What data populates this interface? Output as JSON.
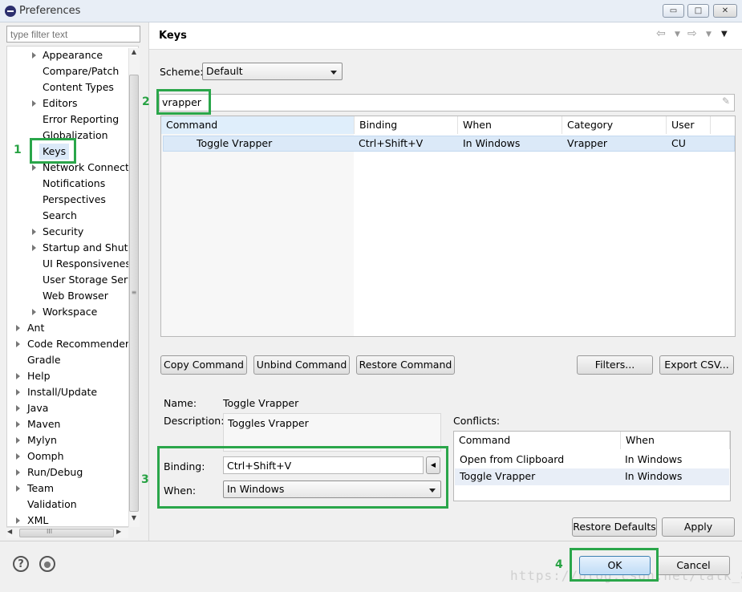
{
  "window": {
    "title": "Preferences",
    "min_glyph": "▭",
    "max_glyph": "□",
    "close_glyph": "✕"
  },
  "filter": {
    "placeholder": "type filter text"
  },
  "tree": {
    "items": [
      {
        "label": "Appearance",
        "arrow": true
      },
      {
        "label": "Compare/Patch",
        "arrow": false
      },
      {
        "label": "Content Types",
        "arrow": false
      },
      {
        "label": "Editors",
        "arrow": true
      },
      {
        "label": "Error Reporting",
        "arrow": false
      },
      {
        "label": "Globalization",
        "arrow": false
      },
      {
        "label": "Keys",
        "arrow": false,
        "selected": true
      },
      {
        "label": "Network Connectio",
        "arrow": true
      },
      {
        "label": "Notifications",
        "arrow": false
      },
      {
        "label": "Perspectives",
        "arrow": false
      },
      {
        "label": "Search",
        "arrow": false
      },
      {
        "label": "Security",
        "arrow": true
      },
      {
        "label": "Startup and Shutd",
        "arrow": true
      },
      {
        "label": "UI Responsiveness",
        "arrow": false
      },
      {
        "label": "User Storage Serv",
        "arrow": false
      },
      {
        "label": "Web Browser",
        "arrow": false
      },
      {
        "label": "Workspace",
        "arrow": true
      }
    ],
    "top_items": [
      {
        "label": "Ant",
        "arrow": true
      },
      {
        "label": "Code Recommenders",
        "arrow": true
      },
      {
        "label": "Gradle",
        "arrow": false
      },
      {
        "label": "Help",
        "arrow": true
      },
      {
        "label": "Install/Update",
        "arrow": true
      },
      {
        "label": "Java",
        "arrow": true
      },
      {
        "label": "Maven",
        "arrow": true
      },
      {
        "label": "Mylyn",
        "arrow": true
      },
      {
        "label": "Oomph",
        "arrow": true
      },
      {
        "label": "Run/Debug",
        "arrow": true
      },
      {
        "label": "Team",
        "arrow": true
      },
      {
        "label": "Validation",
        "arrow": false
      },
      {
        "label": "XML",
        "arrow": true
      }
    ],
    "scroll_h_thumb": "III"
  },
  "page": {
    "title": "Keys",
    "scheme_label": "Scheme:",
    "scheme_value": "Default",
    "search_value": "vrapper",
    "columns": [
      "Command",
      "Binding",
      "When",
      "Category",
      "User"
    ],
    "rows": [
      {
        "command": "Toggle Vrapper",
        "binding": "Ctrl+Shift+V",
        "when": "In Windows",
        "category": "Vrapper",
        "user": "CU"
      }
    ],
    "buttons": {
      "copy": "Copy Command",
      "unbind": "Unbind Command",
      "restore": "Restore Command",
      "filters": "Filters...",
      "export": "Export CSV..."
    },
    "details": {
      "name_label": "Name:",
      "name_value": "Toggle Vrapper",
      "desc_label": "Description:",
      "desc_value": "Toggles Vrapper",
      "binding_label": "Binding:",
      "binding_value": "Ctrl+Shift+V",
      "when_label": "When:",
      "when_value": "In Windows"
    },
    "conflicts": {
      "label": "Conflicts:",
      "columns": [
        "Command",
        "When"
      ],
      "rows": [
        {
          "command": "Open from Clipboard",
          "when": "In Windows"
        },
        {
          "command": "Toggle Vrapper",
          "when": "In Windows"
        }
      ]
    },
    "restore_defaults": "Restore Defaults",
    "apply": "Apply"
  },
  "footer": {
    "ok": "OK",
    "cancel": "Cancel",
    "help_glyph": "?",
    "watermark": "https://blog.csdn.net/talk_8"
  },
  "annotations": {
    "n1": "1",
    "n2": "2",
    "n3": "3",
    "n4": "4"
  },
  "colors": {
    "highlight": "#2aa64a",
    "selection": "#dbe9f8"
  }
}
